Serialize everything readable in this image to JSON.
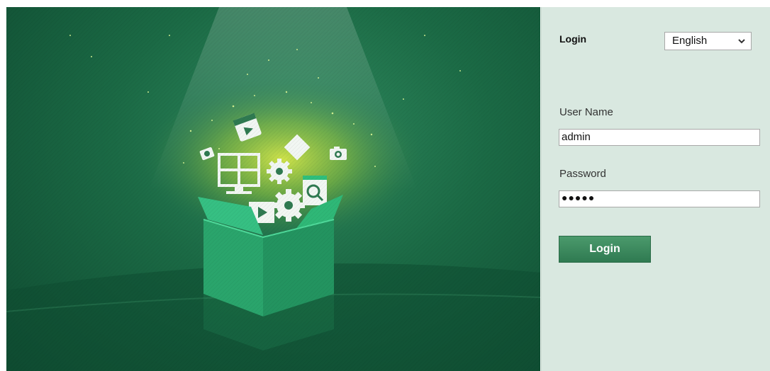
{
  "login_panel": {
    "title": "Login",
    "language": {
      "selected": "English",
      "icon": "chevron-down-icon"
    },
    "username": {
      "label": "User Name",
      "value": "admin"
    },
    "password": {
      "label": "Password",
      "masked_value": "●●●●●"
    },
    "login_button": "Login"
  },
  "colors": {
    "hero_green": "#1b6a45",
    "box_green": "#2fbf7c",
    "panel_bg": "#d9e8e0",
    "button_green": "#3c8a5e"
  }
}
